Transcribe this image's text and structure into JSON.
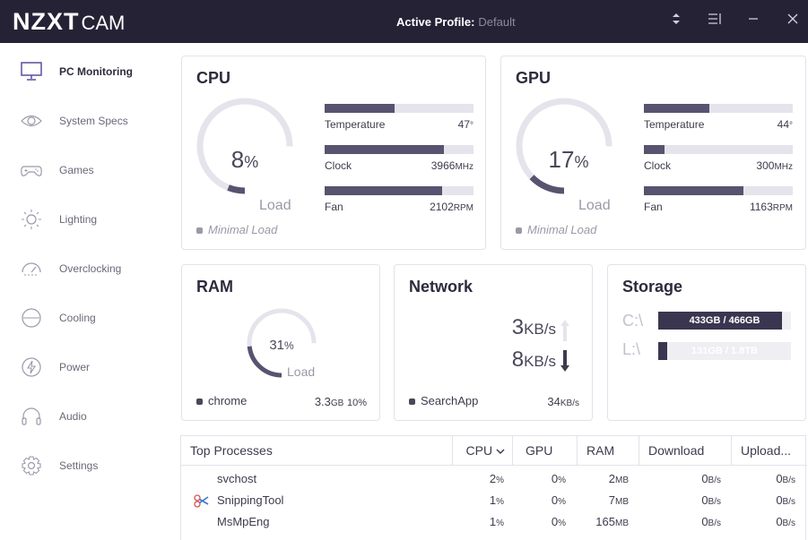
{
  "app": {
    "brand": "NZXT",
    "product": "CAM"
  },
  "titlebar": {
    "profile_label": "Active Profile:",
    "profile_value": "Default"
  },
  "sidebar": {
    "items": [
      {
        "label": "PC Monitoring",
        "icon": "monitor-icon",
        "active": true
      },
      {
        "label": "System Specs",
        "icon": "eye-icon"
      },
      {
        "label": "Games",
        "icon": "gamepad-icon"
      },
      {
        "label": "Lighting",
        "icon": "sun-icon"
      },
      {
        "label": "Overclocking",
        "icon": "speedometer-icon"
      },
      {
        "label": "Cooling",
        "icon": "fan-icon"
      },
      {
        "label": "Power",
        "icon": "lightning-icon"
      },
      {
        "label": "Audio",
        "icon": "headphones-icon"
      },
      {
        "label": "Settings",
        "icon": "gear-icon"
      }
    ]
  },
  "cpu": {
    "title": "CPU",
    "load_value": "8",
    "load_unit": "%",
    "load_label": "Load",
    "load_fraction": 0.08,
    "status": "Minimal Load",
    "temperature": {
      "label": "Temperature",
      "value": "47",
      "unit": "°",
      "fraction": 0.47
    },
    "clock": {
      "label": "Clock",
      "value": "3966",
      "unit": "MHz",
      "fraction": 0.8
    },
    "fan": {
      "label": "Fan",
      "value": "2102",
      "unit": "RPM",
      "fraction": 0.79
    }
  },
  "gpu": {
    "title": "GPU",
    "load_value": "17",
    "load_unit": "%",
    "load_label": "Load",
    "load_fraction": 0.17,
    "status": "Minimal Load",
    "temperature": {
      "label": "Temperature",
      "value": "44",
      "unit": "°",
      "fraction": 0.44
    },
    "clock": {
      "label": "Clock",
      "value": "300",
      "unit": "MHz",
      "fraction": 0.14
    },
    "fan": {
      "label": "Fan",
      "value": "1163",
      "unit": "RPM",
      "fraction": 0.67
    }
  },
  "ram": {
    "title": "RAM",
    "load_value": "31",
    "load_unit": "%",
    "load_label": "Load",
    "load_fraction": 0.31,
    "top_process": "chrome",
    "top_value": "3.3",
    "top_unit": "GB",
    "top_percent": "10%"
  },
  "network": {
    "title": "Network",
    "upload_value": "3",
    "upload_unit": "KB/s",
    "download_value": "8",
    "download_unit": "KB/s",
    "top_process": "SearchApp",
    "top_value": "34",
    "top_unit": "KB/s"
  },
  "storage": {
    "title": "Storage",
    "drives": [
      {
        "label": "C:\\",
        "text": "433GB / 466GB",
        "fraction": 0.93
      },
      {
        "label": "L:\\",
        "text": "131GB / 1.8TB",
        "fraction": 0.07
      }
    ]
  },
  "processes": {
    "headers": {
      "name": "Top Processes",
      "cpu": "CPU",
      "gpu": "GPU",
      "ram": "RAM",
      "download": "Download",
      "upload": "Upload..."
    },
    "rows": [
      {
        "name": "svchost",
        "cpu": "2",
        "gpu": "0",
        "ram": "2",
        "ram_unit": "MB",
        "download": "0",
        "upload": "0",
        "icon": ""
      },
      {
        "name": "SnippingTool",
        "cpu": "1",
        "gpu": "0",
        "ram": "7",
        "ram_unit": "MB",
        "download": "0",
        "upload": "0",
        "icon": "scissors-icon"
      },
      {
        "name": "MsMpEng",
        "cpu": "1",
        "gpu": "0",
        "ram": "165",
        "ram_unit": "MB",
        "download": "0",
        "upload": "0",
        "icon": ""
      }
    ],
    "pct": "%",
    "rate_unit": "B/s"
  },
  "colors": {
    "titlebar": "#262236",
    "accent": "#58536e",
    "track": "#e5e4ec"
  }
}
